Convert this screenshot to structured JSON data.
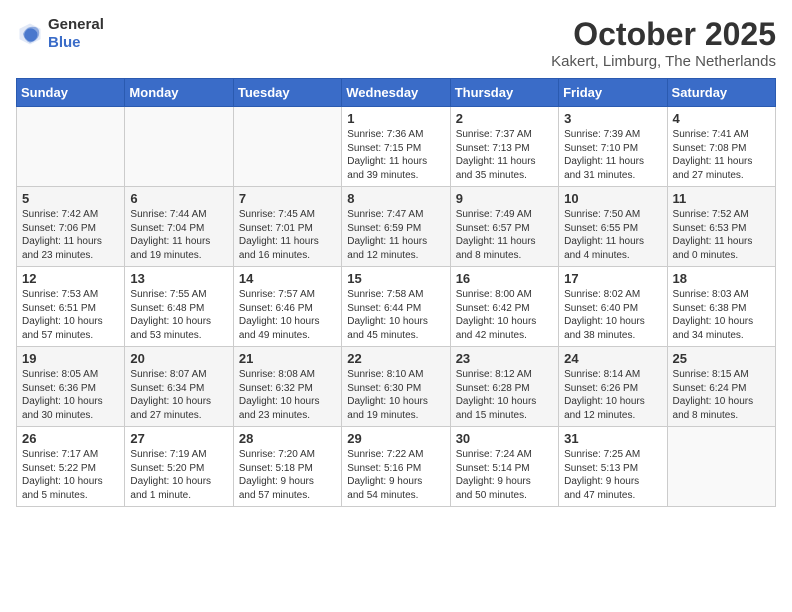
{
  "header": {
    "logo_general": "General",
    "logo_blue": "Blue",
    "month_title": "October 2025",
    "location": "Kakert, Limburg, The Netherlands"
  },
  "weekdays": [
    "Sunday",
    "Monday",
    "Tuesday",
    "Wednesday",
    "Thursday",
    "Friday",
    "Saturday"
  ],
  "weeks": [
    [
      {
        "day": "",
        "info": ""
      },
      {
        "day": "",
        "info": ""
      },
      {
        "day": "",
        "info": ""
      },
      {
        "day": "1",
        "info": "Sunrise: 7:36 AM\nSunset: 7:15 PM\nDaylight: 11 hours\nand 39 minutes."
      },
      {
        "day": "2",
        "info": "Sunrise: 7:37 AM\nSunset: 7:13 PM\nDaylight: 11 hours\nand 35 minutes."
      },
      {
        "day": "3",
        "info": "Sunrise: 7:39 AM\nSunset: 7:10 PM\nDaylight: 11 hours\nand 31 minutes."
      },
      {
        "day": "4",
        "info": "Sunrise: 7:41 AM\nSunset: 7:08 PM\nDaylight: 11 hours\nand 27 minutes."
      }
    ],
    [
      {
        "day": "5",
        "info": "Sunrise: 7:42 AM\nSunset: 7:06 PM\nDaylight: 11 hours\nand 23 minutes."
      },
      {
        "day": "6",
        "info": "Sunrise: 7:44 AM\nSunset: 7:04 PM\nDaylight: 11 hours\nand 19 minutes."
      },
      {
        "day": "7",
        "info": "Sunrise: 7:45 AM\nSunset: 7:01 PM\nDaylight: 11 hours\nand 16 minutes."
      },
      {
        "day": "8",
        "info": "Sunrise: 7:47 AM\nSunset: 6:59 PM\nDaylight: 11 hours\nand 12 minutes."
      },
      {
        "day": "9",
        "info": "Sunrise: 7:49 AM\nSunset: 6:57 PM\nDaylight: 11 hours\nand 8 minutes."
      },
      {
        "day": "10",
        "info": "Sunrise: 7:50 AM\nSunset: 6:55 PM\nDaylight: 11 hours\nand 4 minutes."
      },
      {
        "day": "11",
        "info": "Sunrise: 7:52 AM\nSunset: 6:53 PM\nDaylight: 11 hours\nand 0 minutes."
      }
    ],
    [
      {
        "day": "12",
        "info": "Sunrise: 7:53 AM\nSunset: 6:51 PM\nDaylight: 10 hours\nand 57 minutes."
      },
      {
        "day": "13",
        "info": "Sunrise: 7:55 AM\nSunset: 6:48 PM\nDaylight: 10 hours\nand 53 minutes."
      },
      {
        "day": "14",
        "info": "Sunrise: 7:57 AM\nSunset: 6:46 PM\nDaylight: 10 hours\nand 49 minutes."
      },
      {
        "day": "15",
        "info": "Sunrise: 7:58 AM\nSunset: 6:44 PM\nDaylight: 10 hours\nand 45 minutes."
      },
      {
        "day": "16",
        "info": "Sunrise: 8:00 AM\nSunset: 6:42 PM\nDaylight: 10 hours\nand 42 minutes."
      },
      {
        "day": "17",
        "info": "Sunrise: 8:02 AM\nSunset: 6:40 PM\nDaylight: 10 hours\nand 38 minutes."
      },
      {
        "day": "18",
        "info": "Sunrise: 8:03 AM\nSunset: 6:38 PM\nDaylight: 10 hours\nand 34 minutes."
      }
    ],
    [
      {
        "day": "19",
        "info": "Sunrise: 8:05 AM\nSunset: 6:36 PM\nDaylight: 10 hours\nand 30 minutes."
      },
      {
        "day": "20",
        "info": "Sunrise: 8:07 AM\nSunset: 6:34 PM\nDaylight: 10 hours\nand 27 minutes."
      },
      {
        "day": "21",
        "info": "Sunrise: 8:08 AM\nSunset: 6:32 PM\nDaylight: 10 hours\nand 23 minutes."
      },
      {
        "day": "22",
        "info": "Sunrise: 8:10 AM\nSunset: 6:30 PM\nDaylight: 10 hours\nand 19 minutes."
      },
      {
        "day": "23",
        "info": "Sunrise: 8:12 AM\nSunset: 6:28 PM\nDaylight: 10 hours\nand 15 minutes."
      },
      {
        "day": "24",
        "info": "Sunrise: 8:14 AM\nSunset: 6:26 PM\nDaylight: 10 hours\nand 12 minutes."
      },
      {
        "day": "25",
        "info": "Sunrise: 8:15 AM\nSunset: 6:24 PM\nDaylight: 10 hours\nand 8 minutes."
      }
    ],
    [
      {
        "day": "26",
        "info": "Sunrise: 7:17 AM\nSunset: 5:22 PM\nDaylight: 10 hours\nand 5 minutes."
      },
      {
        "day": "27",
        "info": "Sunrise: 7:19 AM\nSunset: 5:20 PM\nDaylight: 10 hours\nand 1 minute."
      },
      {
        "day": "28",
        "info": "Sunrise: 7:20 AM\nSunset: 5:18 PM\nDaylight: 9 hours\nand 57 minutes."
      },
      {
        "day": "29",
        "info": "Sunrise: 7:22 AM\nSunset: 5:16 PM\nDaylight: 9 hours\nand 54 minutes."
      },
      {
        "day": "30",
        "info": "Sunrise: 7:24 AM\nSunset: 5:14 PM\nDaylight: 9 hours\nand 50 minutes."
      },
      {
        "day": "31",
        "info": "Sunrise: 7:25 AM\nSunset: 5:13 PM\nDaylight: 9 hours\nand 47 minutes."
      },
      {
        "day": "",
        "info": ""
      }
    ]
  ]
}
